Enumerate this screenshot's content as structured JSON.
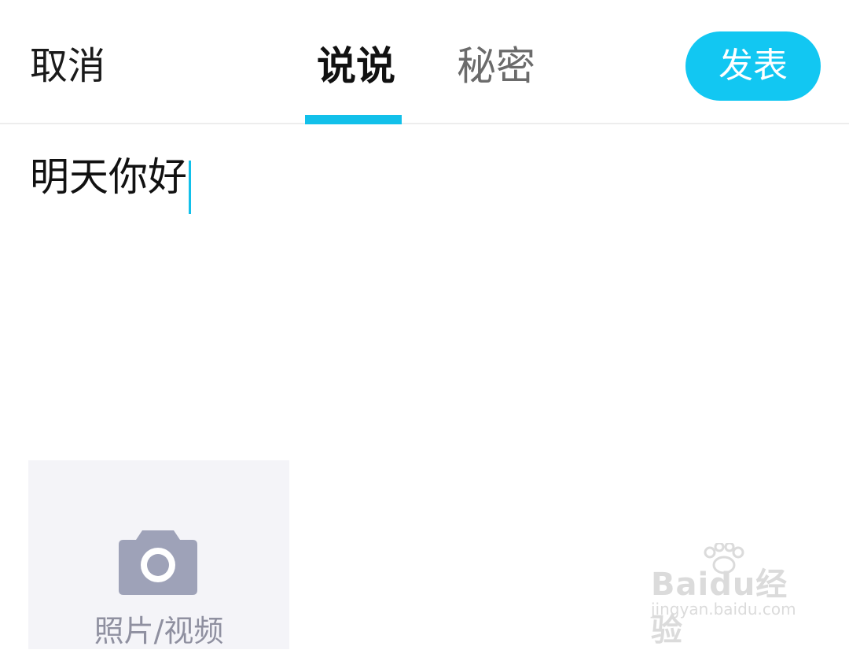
{
  "header": {
    "cancel_label": "取消",
    "tabs": [
      {
        "label": "说说",
        "active": true
      },
      {
        "label": "秘密",
        "active": false
      }
    ],
    "publish_label": "发表"
  },
  "editor": {
    "text": "明天你好"
  },
  "media": {
    "label": "照片/视频",
    "icon": "camera-icon"
  },
  "watermark": {
    "logo_text": "Baidu经验",
    "url": "jingyan.baidu.com"
  },
  "colors": {
    "accent": "#12c7f2",
    "tile_bg": "#f4f4f8",
    "icon_gray": "#9ea2b8"
  }
}
